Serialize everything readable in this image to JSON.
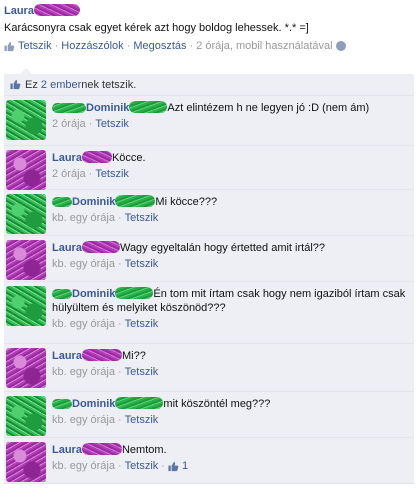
{
  "post": {
    "author": "Laura",
    "text": "Karácsonyra csak egyet kérek azt hogy boldog lehessek. *.* =]",
    "actions": [
      "Tetszik",
      "Hozzászólok",
      "Megosztás"
    ],
    "time": "2 órája, mobil használatával",
    "separator": "·"
  },
  "likes": {
    "prefix": "Ez",
    "link": "2 ember",
    "suffix": "nek tetszik."
  },
  "comments": [
    {
      "author": "Dominik",
      "text": "Azt elintézem h ne legyen jó :D (nem ám)",
      "time": "2 órája",
      "action": "Tetszik",
      "avatar": "green"
    },
    {
      "author": "Laura",
      "text": "Köcce.",
      "time": "2 órája",
      "action": "Tetszik",
      "avatar": "purple"
    },
    {
      "author": "Dominik",
      "text": "Mi köcce???",
      "time": "kb. egy órája",
      "action": "Tetszik",
      "avatar": "green"
    },
    {
      "author": "Laura",
      "text": "Wagy egyeltalán hogy értetted amit irtál??",
      "time": "kb. egy órája",
      "action": "Tetszik",
      "avatar": "purple"
    },
    {
      "author": "Dominik",
      "text": "Én tom mit írtam csak hogy nem igaziból írtam csak hülyültem és melyiket köszönöd???",
      "time": "kb. egy órája",
      "action": "Tetszik",
      "avatar": "green"
    },
    {
      "author": "Laura",
      "text": "Mi??",
      "time": "kb. egy órája",
      "action": "Tetszik",
      "avatar": "purple"
    },
    {
      "author": "Dominik",
      "text": "mit köszöntél meg???",
      "time": "kb. egy órája",
      "action": "Tetszik",
      "avatar": "green"
    },
    {
      "author": "Laura",
      "text": "Nemtom.",
      "time": "kb. egy órája",
      "action": "Tetszik",
      "avatar": "purple",
      "like_count": "1"
    }
  ]
}
